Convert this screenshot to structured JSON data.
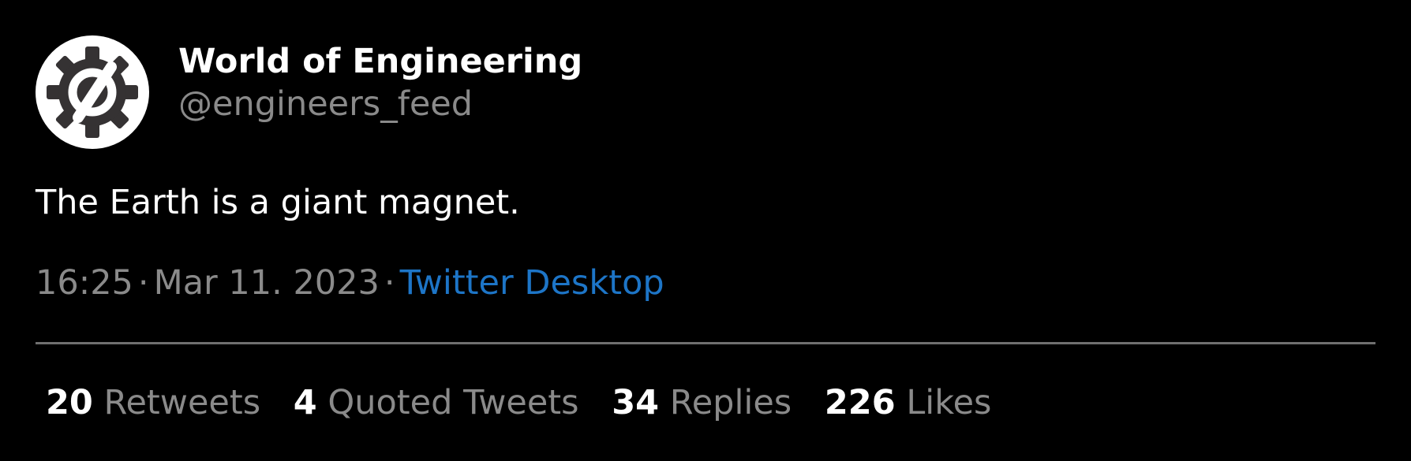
{
  "colors": {
    "background": "#000000",
    "primary_text": "#ffffff",
    "secondary_text": "#8a8a8a",
    "link": "#1d75c7",
    "divider": "#6f6f6f",
    "avatar_bg": "#ffffff",
    "avatar_icon": "#353233"
  },
  "author": {
    "display_name": "World of Engineering",
    "handle": "@engineers_feed",
    "avatar_icon": "gear-icon"
  },
  "tweet": {
    "text": "The Earth is a giant magnet.",
    "time": "16:25",
    "separator": "·",
    "date": "Mar 11. 2023",
    "source": "Twitter Desktop"
  },
  "stats": [
    {
      "count": "20",
      "label": "Retweets"
    },
    {
      "count": "4",
      "label": "Quoted Tweets"
    },
    {
      "count": "34",
      "label": "Replies"
    },
    {
      "count": "226",
      "label": "Likes"
    }
  ]
}
